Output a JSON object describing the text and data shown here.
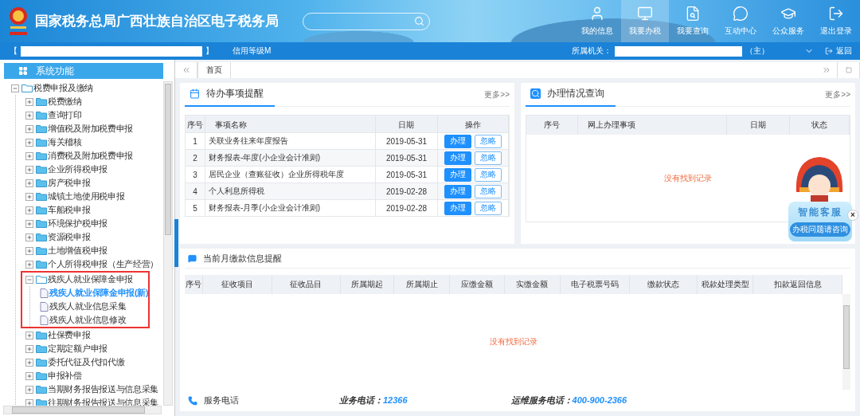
{
  "header": {
    "title": "国家税务总局广西壮族自治区电子税务局"
  },
  "nav": [
    {
      "label": "我的信息",
      "selected": false
    },
    {
      "label": "我要办税",
      "selected": true
    },
    {
      "label": "我要查询",
      "selected": false
    },
    {
      "label": "互动中心",
      "selected": false
    },
    {
      "label": "公众服务",
      "selected": false
    },
    {
      "label": "退出登录",
      "selected": false
    }
  ],
  "info_bar": {
    "open_bracket": "【",
    "close_bracket": "】",
    "credit": "信用等级M",
    "office_label": "所属机关：",
    "office_suffix": "（主）",
    "back": "返回"
  },
  "sidebar": {
    "title": "系统功能",
    "tree": [
      {
        "label": "税费申报及缴纳",
        "kind": "folder",
        "expanded": true,
        "selected": false,
        "children": [
          {
            "label": "税费缴纳",
            "kind": "folder",
            "expanded": false,
            "selected": false
          },
          {
            "label": "查询打印",
            "kind": "folder",
            "expanded": false,
            "selected": false
          },
          {
            "label": "增值税及附加税费申报",
            "kind": "folder",
            "expanded": false,
            "selected": false
          },
          {
            "label": "海关稽核",
            "kind": "folder",
            "expanded": false,
            "selected": false
          },
          {
            "label": "消费税及附加税费申报",
            "kind": "folder",
            "expanded": false,
            "selected": false
          },
          {
            "label": "企业所得税申报",
            "kind": "folder",
            "expanded": false,
            "selected": false
          },
          {
            "label": "房产税申报",
            "kind": "folder",
            "expanded": false,
            "selected": false
          },
          {
            "label": "城镇土地使用税申报",
            "kind": "folder",
            "expanded": false,
            "selected": false
          },
          {
            "label": "车船税申报",
            "kind": "folder",
            "expanded": false,
            "selected": false
          },
          {
            "label": "环境保护税申报",
            "kind": "folder",
            "expanded": false,
            "selected": false
          },
          {
            "label": "资源税申报",
            "kind": "folder",
            "expanded": false,
            "selected": false
          },
          {
            "label": "土地增值税申报",
            "kind": "folder",
            "expanded": false,
            "selected": false
          },
          {
            "label": "个人所得税申报（生产经营）",
            "kind": "folder",
            "expanded": false,
            "selected": false
          },
          {
            "label": "残疾人就业保障金申报",
            "kind": "folder",
            "expanded": true,
            "selected": false,
            "highlighted": true,
            "children": [
              {
                "label": "残疾人就业保障金申报(新)",
                "kind": "file",
                "selected": true
              },
              {
                "label": "残疾人就业信息采集",
                "kind": "file",
                "selected": false
              },
              {
                "label": "残疾人就业信息修改",
                "kind": "file",
                "selected": false
              }
            ]
          },
          {
            "label": "社保费申报",
            "kind": "folder",
            "expanded": false,
            "selected": false
          },
          {
            "label": "定期定额户申报",
            "kind": "folder",
            "expanded": false,
            "selected": false
          },
          {
            "label": "委托代征及代扣代缴",
            "kind": "folder",
            "expanded": false,
            "selected": false
          },
          {
            "label": "申报补偿",
            "kind": "folder",
            "expanded": false,
            "selected": false
          },
          {
            "label": "当期财务报告报送与信息采集",
            "kind": "folder",
            "expanded": false,
            "selected": false
          },
          {
            "label": "往期财务报告报送与信息采集",
            "kind": "folder",
            "expanded": false,
            "selected": false
          }
        ]
      }
    ]
  },
  "tabs": [
    {
      "label": "首页",
      "selected": true
    }
  ],
  "todo": {
    "title": "待办事项提醒",
    "more": "更多>>",
    "columns": [
      "序号",
      "事项名称",
      "日期",
      "操作"
    ],
    "rows": [
      {
        "cells": [
          "1",
          "关联业务往来年度报告",
          "2019-05-31"
        ],
        "actions": [
          "办理",
          "忽略"
        ]
      },
      {
        "cells": [
          "2",
          "财务报表-年度(小企业会计准则)",
          "2019-05-31"
        ],
        "actions": [
          "办理",
          "忽略"
        ]
      },
      {
        "cells": [
          "3",
          "居民企业（查账征收）企业所得税年度",
          "2019-05-31"
        ],
        "actions": [
          "办理",
          "忽略"
        ]
      },
      {
        "cells": [
          "4",
          "个人利息所得税",
          "2019-02-28"
        ],
        "actions": [
          "办理",
          "忽略"
        ]
      },
      {
        "cells": [
          "5",
          "财务报表-月季(小企业会计准则)",
          "2019-02-28"
        ],
        "actions": [
          "办理",
          "忽略"
        ]
      }
    ]
  },
  "query": {
    "title": "办理情况查询",
    "more": "更多>>",
    "columns": [
      "序号",
      "网上办理事项",
      "日期",
      "状态"
    ],
    "empty": "没有找到记录"
  },
  "payments": {
    "title": "当前月缴款信息提醒",
    "columns": [
      "序号",
      "征收项目",
      "征收品目",
      "所属期起",
      "所属期止",
      "应缴金额",
      "实缴金额",
      "电子税票号码",
      "缴款状态",
      "税款处理类型",
      "扣款返回信息"
    ],
    "empty": "没有找到记录"
  },
  "service": {
    "title": "服务电话",
    "lines": [
      {
        "label": "业务电话：",
        "number": "12366"
      },
      {
        "label": "运维服务电话：",
        "number": "400-900-2366"
      }
    ]
  },
  "assistant": {
    "title": "智能客服",
    "subtitle": "办税问题请咨询",
    "close": "×"
  }
}
